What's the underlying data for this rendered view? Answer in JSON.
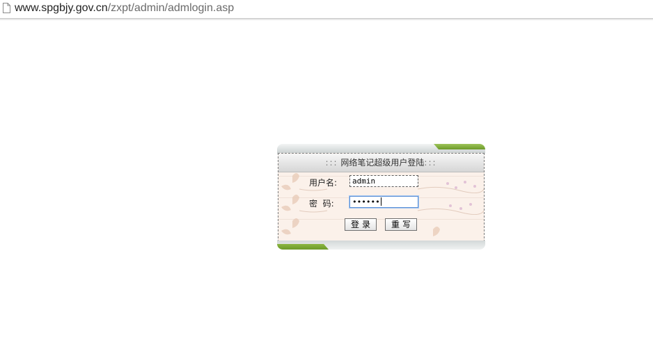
{
  "address_bar": {
    "url_host": "www.spgbjy.gov.cn",
    "url_path": "/zxpt/admin/admlogin.asp",
    "icon": "page-icon"
  },
  "login": {
    "title_prefix": ":::",
    "title": "网络笔记超级用户登陆",
    "title_suffix": ":::",
    "username_label": "用户名:",
    "username_value": "admin",
    "password_label": "密  码:",
    "password_value": "••••••",
    "login_button": "登录",
    "reset_button": "重写"
  },
  "colors": {
    "accent_green": "#7aa832",
    "panel_bg": "#fbf1ea",
    "focus_blue": "#5a8fd6"
  }
}
